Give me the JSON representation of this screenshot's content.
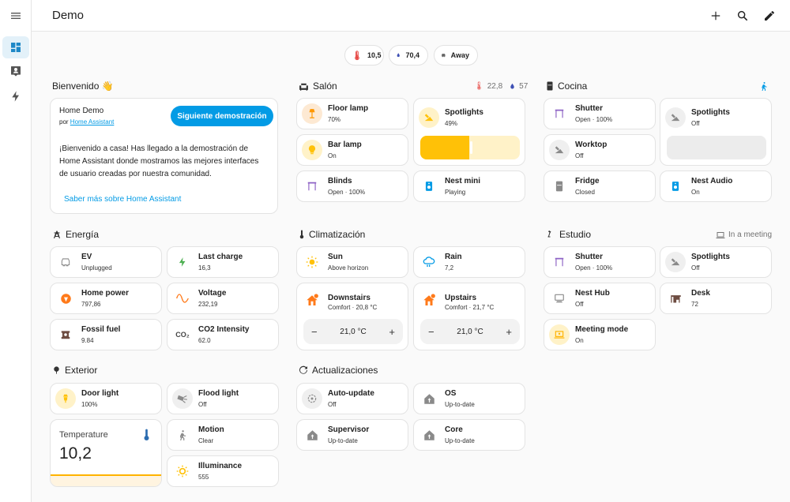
{
  "app": {
    "title": "Demo"
  },
  "badges": [
    {
      "value": "10,5"
    },
    {
      "value": "70,4"
    },
    {
      "value": "Away"
    }
  ],
  "welcome": {
    "title": "Bienvenido 👋",
    "card_title": "Home Demo",
    "by_prefix": "por",
    "by_link": "Home Assistant",
    "next_button": "Siguiente demostración",
    "body": "¡Bienvenido a casa! Has llegado a la demostración de Home Assistant donde mostramos las mejores interfaces de usuario creadas por nuestra comunidad.",
    "learn_more": "Saber más sobre Home Assistant"
  },
  "salon": {
    "title": "Salón",
    "temp": "22,8",
    "humidity": "57",
    "tiles": [
      {
        "name": "Floor lamp",
        "state": "70%"
      },
      {
        "name": "Spotlights",
        "state": "49%"
      },
      {
        "name": "Bar lamp",
        "state": "On"
      },
      {
        "name": "Blinds",
        "state": "Open · 100%"
      },
      {
        "name": "Nest mini",
        "state": "Playing"
      }
    ],
    "spotlight_level": 0.49
  },
  "cocina": {
    "title": "Cocina",
    "tiles": [
      {
        "name": "Shutter",
        "state": "Open · 100%"
      },
      {
        "name": "Spotlights",
        "state": "Off"
      },
      {
        "name": "Worktop",
        "state": "Off"
      },
      {
        "name": "Fridge",
        "state": "Closed"
      },
      {
        "name": "Nest Audio",
        "state": "On"
      }
    ]
  },
  "energia": {
    "title": "Energía",
    "tiles": [
      {
        "name": "EV",
        "state": "Unplugged"
      },
      {
        "name": "Last charge",
        "state": "16,3"
      },
      {
        "name": "Home power",
        "state": "797,86"
      },
      {
        "name": "Voltage",
        "state": "232,19"
      },
      {
        "name": "Fossil fuel",
        "state": "9.84"
      },
      {
        "name": "CO2 Intensity",
        "state": "62.0"
      }
    ]
  },
  "clima": {
    "title": "Climatización",
    "tiles": [
      {
        "name": "Sun",
        "state": "Above horizon"
      },
      {
        "name": "Rain",
        "state": "7,2"
      },
      {
        "name": "Downstairs",
        "state": "Comfort · 20,8 °C"
      },
      {
        "name": "Upstairs",
        "state": "Comfort · 21,7 °C"
      }
    ],
    "setpoints": [
      "21,0 °C",
      "21,0 °C"
    ],
    "minus": "−",
    "plus": "+"
  },
  "estudio": {
    "title": "Estudio",
    "status": "In a meeting",
    "tiles": [
      {
        "name": "Shutter",
        "state": "Open · 100%"
      },
      {
        "name": "Spotlights",
        "state": "Off"
      },
      {
        "name": "Nest Hub",
        "state": "Off"
      },
      {
        "name": "Desk",
        "state": "72"
      },
      {
        "name": "Meeting mode",
        "state": "On"
      }
    ]
  },
  "exterior": {
    "title": "Exterior",
    "tiles": [
      {
        "name": "Door light",
        "state": "100%"
      },
      {
        "name": "Flood light",
        "state": "Off"
      },
      {
        "name": "Motion",
        "state": "Clear"
      },
      {
        "name": "Illuminance",
        "state": "555"
      }
    ],
    "temperature": {
      "label": "Temperature",
      "value": "10,2"
    }
  },
  "actualizaciones": {
    "title": "Actualizaciones",
    "tiles": [
      {
        "name": "Auto-update",
        "state": "Off"
      },
      {
        "name": "OS",
        "state": "Up-to-date"
      },
      {
        "name": "Supervisor",
        "state": "Up-to-date"
      },
      {
        "name": "Core",
        "state": "Up-to-date"
      }
    ]
  },
  "co2_glyph": "CO₂",
  "colors": {
    "accent": "#039be5",
    "orange": "#ff9800",
    "yellow": "#ffc107",
    "purple": "#8e63c5",
    "gray": "#8a8a8a"
  }
}
